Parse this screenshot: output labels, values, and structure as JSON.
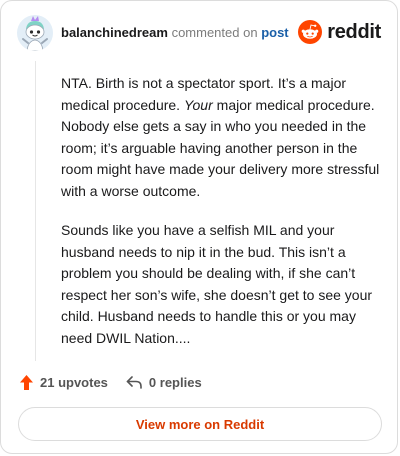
{
  "header": {
    "username": "balanchinedream",
    "action_text": "commented on",
    "post_link": "post",
    "brand": "reddit"
  },
  "comment": {
    "p1_before": "NTA. Birth is not a spectator sport. It’s a major medical procedure. ",
    "p1_emphasis": "Your",
    "p1_after": " major medical procedure. Nobody else gets a say in who you needed in the room; it’s arguable having another person in the room might have made your delivery more stressful with a worse outcome.",
    "p2": "Sounds like you have a selfish MIL and your husband needs to nip it in the bud. This isn’t a problem you should be dealing with, if she can’t respect her son’s wife, she doesn’t get to see your child. Husband needs to handle this or you may need DWIL Nation...."
  },
  "actions": {
    "upvotes": "21 upvotes",
    "replies": "0 replies"
  },
  "footer": {
    "view_more": "View more on Reddit"
  },
  "colors": {
    "brand": "#ff4500",
    "link": "#1a5fa8",
    "view_more": "#d93a00"
  },
  "icons": {
    "avatar": "snoo-avatar-icon",
    "logo": "reddit-snoo-icon",
    "upvote": "upvote-arrow-icon",
    "reply": "reply-arrow-icon"
  }
}
